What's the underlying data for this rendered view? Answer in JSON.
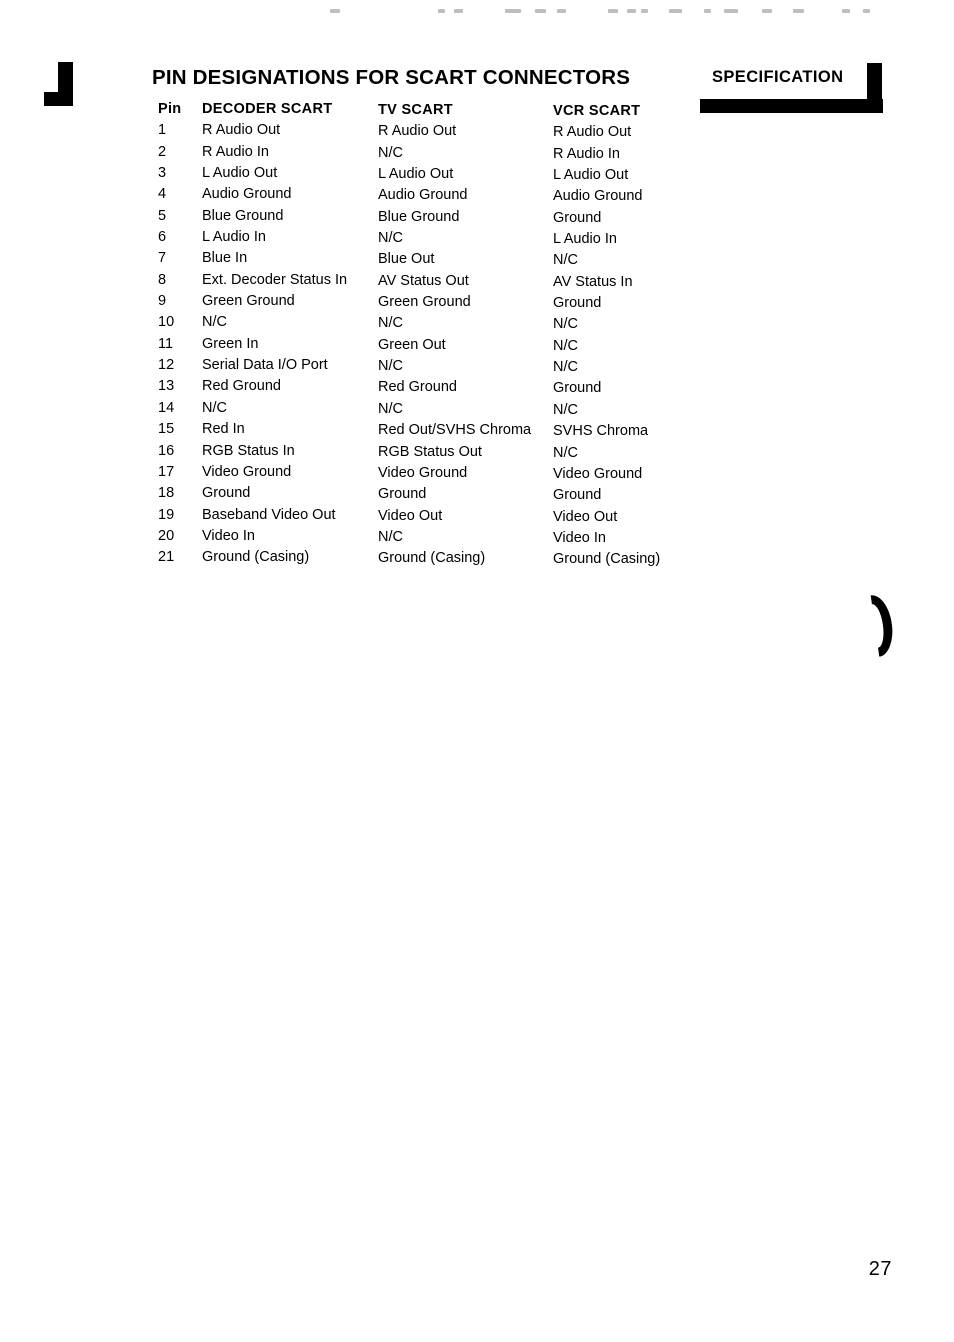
{
  "page": {
    "title": "PIN DESIGNATIONS FOR SCART CONNECTORS",
    "section_header": "SPECIFICATION",
    "folio": "27"
  },
  "table": {
    "columns": [
      "Pin",
      "DECODER SCART",
      "TV SCART",
      "VCR SCART"
    ],
    "rows": [
      {
        "pin": "1",
        "decoder": "R Audio Out",
        "tv": "R Audio Out",
        "vcr": "R Audio Out"
      },
      {
        "pin": "2",
        "decoder": "R Audio In",
        "tv": "N/C",
        "vcr": "R Audio In"
      },
      {
        "pin": "3",
        "decoder": "L Audio Out",
        "tv": "L Audio Out",
        "vcr": "L Audio Out"
      },
      {
        "pin": "4",
        "decoder": "Audio Ground",
        "tv": "Audio Ground",
        "vcr": "Audio Ground"
      },
      {
        "pin": "5",
        "decoder": "Blue Ground",
        "tv": "Blue Ground",
        "vcr": "Ground"
      },
      {
        "pin": "6",
        "decoder": "L Audio In",
        "tv": "N/C",
        "vcr": "L Audio In"
      },
      {
        "pin": "7",
        "decoder": "Blue In",
        "tv": "Blue Out",
        "vcr": "N/C"
      },
      {
        "pin": "8",
        "decoder": "Ext. Decoder Status In",
        "tv": "AV Status Out",
        "vcr": "AV Status In"
      },
      {
        "pin": "9",
        "decoder": "Green Ground",
        "tv": "Green Ground",
        "vcr": "Ground"
      },
      {
        "pin": "10",
        "decoder": "N/C",
        "tv": "N/C",
        "vcr": "N/C"
      },
      {
        "pin": "11",
        "decoder": "Green In",
        "tv": "Green Out",
        "vcr": "N/C"
      },
      {
        "pin": "12",
        "decoder": "Serial Data I/O Port",
        "tv": "N/C",
        "vcr": "N/C"
      },
      {
        "pin": "13",
        "decoder": "Red Ground",
        "tv": "Red Ground",
        "vcr": "Ground"
      },
      {
        "pin": "14",
        "decoder": "N/C",
        "tv": "N/C",
        "vcr": "N/C"
      },
      {
        "pin": "15",
        "decoder": "Red In",
        "tv": "Red Out/SVHS Chroma",
        "vcr": "SVHS Chroma"
      },
      {
        "pin": "16",
        "decoder": "RGB Status In",
        "tv": "RGB Status Out",
        "vcr": "N/C"
      },
      {
        "pin": "17",
        "decoder": "Video Ground",
        "tv": "Video Ground",
        "vcr": "Video Ground"
      },
      {
        "pin": "18",
        "decoder": "Ground",
        "tv": "Ground",
        "vcr": "Ground"
      },
      {
        "pin": "19",
        "decoder": "Baseband Video Out",
        "tv": "Video Out",
        "vcr": "Video Out"
      },
      {
        "pin": "20",
        "decoder": "Video In",
        "tv": "N/C",
        "vcr": "Video In"
      },
      {
        "pin": "21",
        "decoder": "Ground (Casing)",
        "tv": "Ground (Casing)",
        "vcr": "Ground (Casing)"
      }
    ]
  },
  "marks": {
    "corner_register": "corner-register-mark",
    "crescent": "crescent-scan-artifact"
  },
  "colors": {
    "ink": "#000000",
    "paper": "#ffffff"
  }
}
